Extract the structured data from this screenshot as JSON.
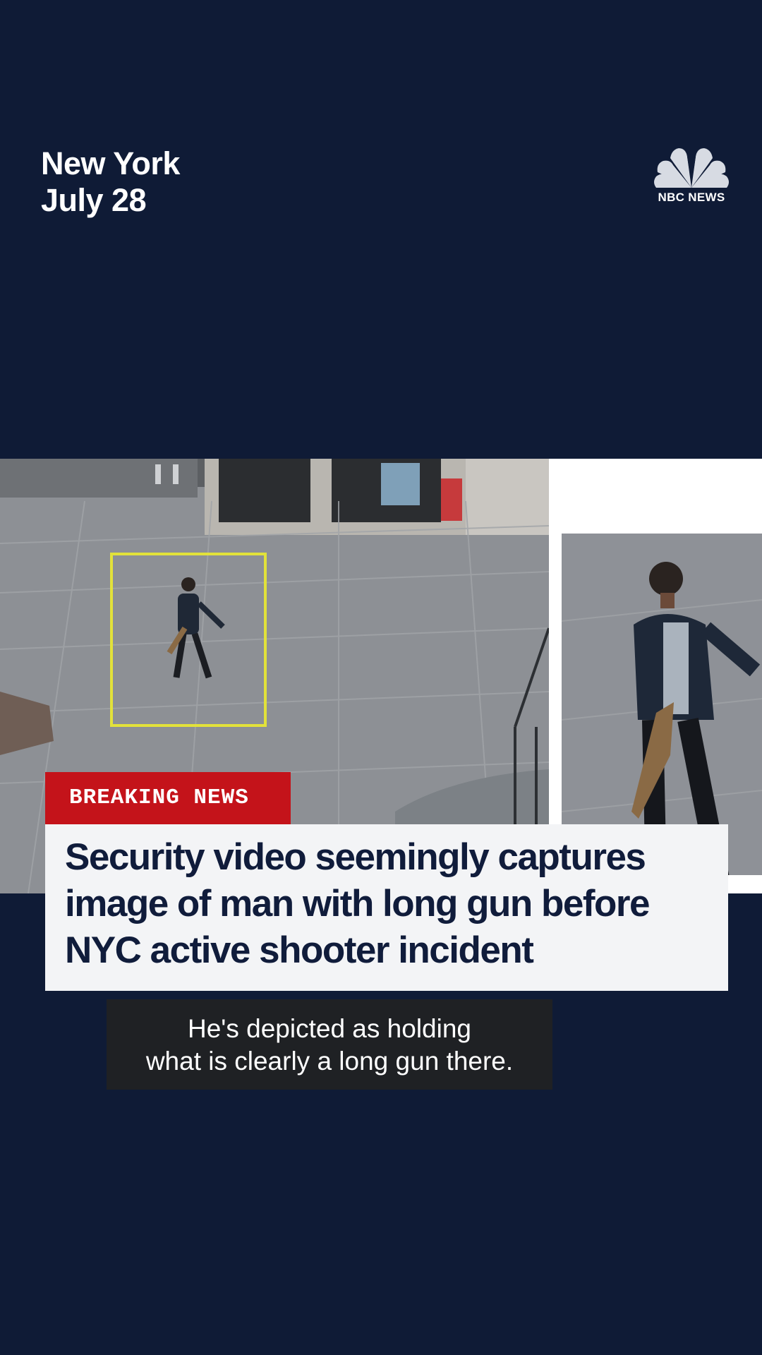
{
  "dateline": {
    "location": "New York",
    "date": "July 28"
  },
  "logo": {
    "icon": "peacock-icon",
    "text": "NBC NEWS"
  },
  "banner": {
    "label": "BREAKING NEWS",
    "color": "#c4131a"
  },
  "headline": {
    "line1": "Security video seemingly captures",
    "line2": "image of man with long gun before",
    "line3": "NYC active shooter incident"
  },
  "caption": {
    "line1": "He's depicted as holding",
    "line2": "what is clearly a long gun there."
  },
  "colors": {
    "background": "#0f1b36",
    "headline_text": "#101c3b",
    "highlight_box": "#e2e23a"
  }
}
